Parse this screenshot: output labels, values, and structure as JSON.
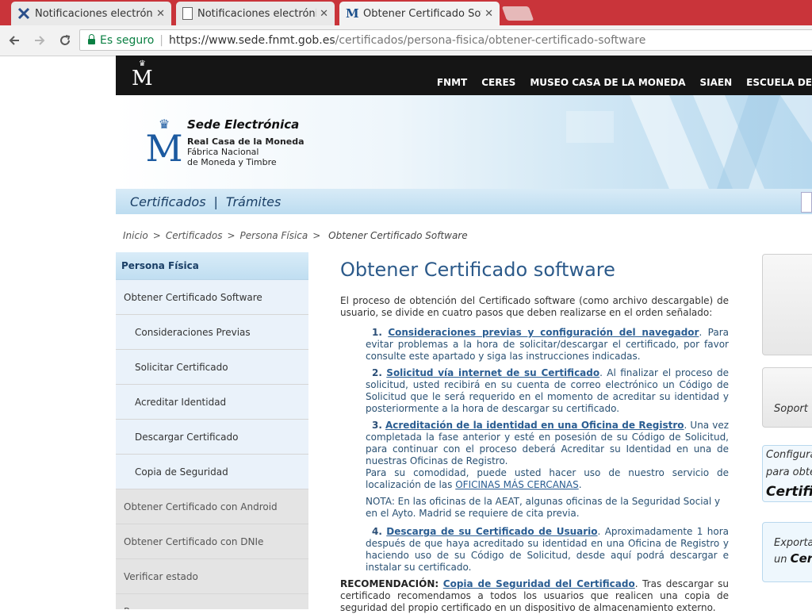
{
  "browser": {
    "tabs": [
      {
        "title": "Notificaciones electrónic",
        "icon": "aeat-x-icon",
        "active": false
      },
      {
        "title": "Notificaciones electrónic",
        "icon": "page-icon",
        "active": false
      },
      {
        "title": "Obtener Certificado Soft",
        "icon": "fnmt-m-icon",
        "active": true
      }
    ],
    "close_glyph": "✕",
    "secure_label": "Es seguro",
    "url_scheme_host": "https://www.sede.fnmt.gob.es",
    "url_path": "/certificados/persona-fisica/obtener-certificado-software"
  },
  "site": {
    "topnav": [
      "FNMT",
      "CERES",
      "MUSEO CASA DE LA MONEDA",
      "SIAEN",
      "ESCUELA DE"
    ],
    "logo": {
      "title": "Sede Electrónica",
      "line1": "Real Casa de la Moneda",
      "line2": "Fábrica Nacional",
      "line3": "de Moneda y Timbre"
    },
    "subnav": [
      "Certificados",
      "Trámites"
    ],
    "subnav_sep": "|",
    "breadcrumb": [
      "Inicio",
      "Certificados",
      "Persona Física",
      "Obtener Certificado Software"
    ],
    "breadcrumb_sep": ">"
  },
  "sidebar": {
    "heading": "Persona Física",
    "items": [
      {
        "label": "Obtener Certificado Software",
        "level": "top"
      },
      {
        "label": "Consideraciones Previas",
        "level": "sub"
      },
      {
        "label": "Solicitar Certificado",
        "level": "sub"
      },
      {
        "label": "Acreditar Identidad",
        "level": "sub"
      },
      {
        "label": "Descargar Certificado",
        "level": "sub"
      },
      {
        "label": "Copia de Seguridad",
        "level": "sub"
      },
      {
        "label": "Obtener Certificado con Android",
        "level": "gray"
      },
      {
        "label": "Obtener Certificado con DNIe",
        "level": "gray"
      },
      {
        "label": "Verificar estado",
        "level": "gray"
      },
      {
        "label": "Renovar",
        "level": "gray"
      }
    ]
  },
  "main": {
    "title": "Obtener Certificado software",
    "intro": "El proceso de obtención del Certificado software (como archivo descargable) de usuario, se divide en cuatro pasos que deben realizarse en el orden señalado:",
    "steps": [
      {
        "num": "1.",
        "link": "Consideraciones previas y configuración del navegador",
        "text": ". Para evitar problemas a la hora de solicitar/descargar el certificado, por favor consulte este apartado y siga las instrucciones indicadas."
      },
      {
        "num": "2.",
        "link": "Solicitud vía internet de su Certificado",
        "text": ". Al finalizar el proceso de solicitud, usted recibirá en su cuenta de correo electrónico un Código de Solicitud que le será requerido en el momento de acreditar su identidad y posteriormente a la hora de descargar su certificado."
      },
      {
        "num": "3.",
        "link": "Acreditación de la identidad en una Oficina de Registro",
        "text": ". Una vez completada la fase anterior y esté en posesión de su Código de Solicitud, para continuar con el proceso deberá Acreditar su Identidad en una de nuestras Oficinas de Registro.",
        "extra": "Para su comodidad, puede usted hacer uso de nuestro servicio de localización de las ",
        "extra_link": "OFICINAS MÁS CERCANAS",
        "extra_end": "."
      },
      {
        "num": "4.",
        "link": "Descarga de su Certificado de Usuario",
        "text": ". Aproximadamente 1 hora después de que haya acreditado su identidad en una Oficina de Registro y haciendo uso de su Código de Solicitud, desde aquí podrá descargar e instalar su certificado."
      }
    ],
    "note": "NOTA: En las oficinas de la AEAT, algunas oficinas de la Seguridad Social y en el Ayto. Madrid se requiere de cita previa.",
    "reco_label": "RECOMENDACIÓN:",
    "reco_link": "Copia de Seguridad del Certificado",
    "reco_text": ". Tras descargar su certificado recomendamos a todos los usuarios que realicen una copia de seguridad del propio certificado en un dispositivo de almacenamiento externo."
  },
  "right": {
    "box2": "Soport",
    "box3_line1": "Configura",
    "box3_line2": "para obte",
    "box3_line3": "Certific",
    "box4_line1": "Exporta",
    "box4_line2_a": "un ",
    "box4_line2_b": "Cer"
  }
}
